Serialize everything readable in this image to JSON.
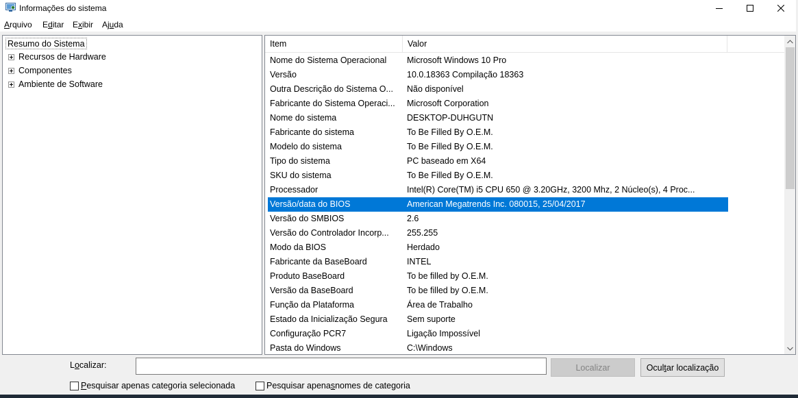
{
  "window": {
    "title": "Informações do sistema"
  },
  "menu": {
    "arquivo": {
      "ul": "A",
      "rest": "rquivo"
    },
    "editar": {
      "pre": "E",
      "ul": "d",
      "rest": "itar"
    },
    "exibir": {
      "pre": "E",
      "ul": "x",
      "rest": "ibir"
    },
    "ajuda": {
      "pre": "Aj",
      "ul": "u",
      "rest": "da"
    }
  },
  "tree": {
    "root": "Resumo do Sistema",
    "nodes": [
      "Recursos de Hardware",
      "Componentes",
      "Ambiente de Software"
    ]
  },
  "list": {
    "col_item": "Item",
    "col_value": "Valor",
    "rows": [
      {
        "item": "Nome do Sistema Operacional",
        "value": "Microsoft Windows 10 Pro"
      },
      {
        "item": "Versão",
        "value": "10.0.18363 Compilação 18363"
      },
      {
        "item": "Outra Descrição do Sistema O...",
        "value": "Não disponível"
      },
      {
        "item": "Fabricante do Sistema Operaci...",
        "value": "Microsoft Corporation"
      },
      {
        "item": "Nome do sistema",
        "value": "DESKTOP-DUHGUTN"
      },
      {
        "item": "Fabricante do sistema",
        "value": "To Be Filled By O.E.M."
      },
      {
        "item": "Modelo do sistema",
        "value": "To Be Filled By O.E.M."
      },
      {
        "item": "Tipo do sistema",
        "value": "PC baseado em X64"
      },
      {
        "item": "SKU do sistema",
        "value": "To Be Filled By O.E.M."
      },
      {
        "item": "Processador",
        "value": "Intel(R) Core(TM) i5 CPU         650  @ 3.20GHz, 3200 Mhz, 2 Núcleo(s), 4 Proc..."
      },
      {
        "item": "Versão/data do BIOS",
        "value": "American Megatrends Inc. 080015, 25/04/2017",
        "selected": true
      },
      {
        "item": "Versão do SMBIOS",
        "value": "2.6"
      },
      {
        "item": "Versão do Controlador Incorp...",
        "value": "255.255"
      },
      {
        "item": "Modo da BIOS",
        "value": "Herdado"
      },
      {
        "item": "Fabricante da BaseBoard",
        "value": "INTEL"
      },
      {
        "item": "Produto BaseBoard",
        "value": "To be filled by O.E.M."
      },
      {
        "item": "Versão da BaseBoard",
        "value": "To be filled by O.E.M."
      },
      {
        "item": "Função da Plataforma",
        "value": "Área de Trabalho"
      },
      {
        "item": "Estado da Inicialização Segura",
        "value": "Sem suporte"
      },
      {
        "item": "Configuração PCR7",
        "value": "Ligação Impossível"
      },
      {
        "item": "Pasta do Windows",
        "value": "C:\\Windows"
      }
    ]
  },
  "search": {
    "label_pre": "L",
    "label_ul": "o",
    "label_rest": "calizar:",
    "input_value": "",
    "find_button": "Localizar",
    "hide_button_pre": "Ocul",
    "hide_button_ul": "t",
    "hide_button_rest": "ar localização",
    "chk_selected_ul": "P",
    "chk_selected_rest": "esquisar apenas categoria selecionada",
    "chk_names_pre": "Pesquisar apena",
    "chk_names_ul": "s",
    "chk_names_rest": " nomes de categoria"
  },
  "colors": {
    "selection": "#0078d7"
  }
}
